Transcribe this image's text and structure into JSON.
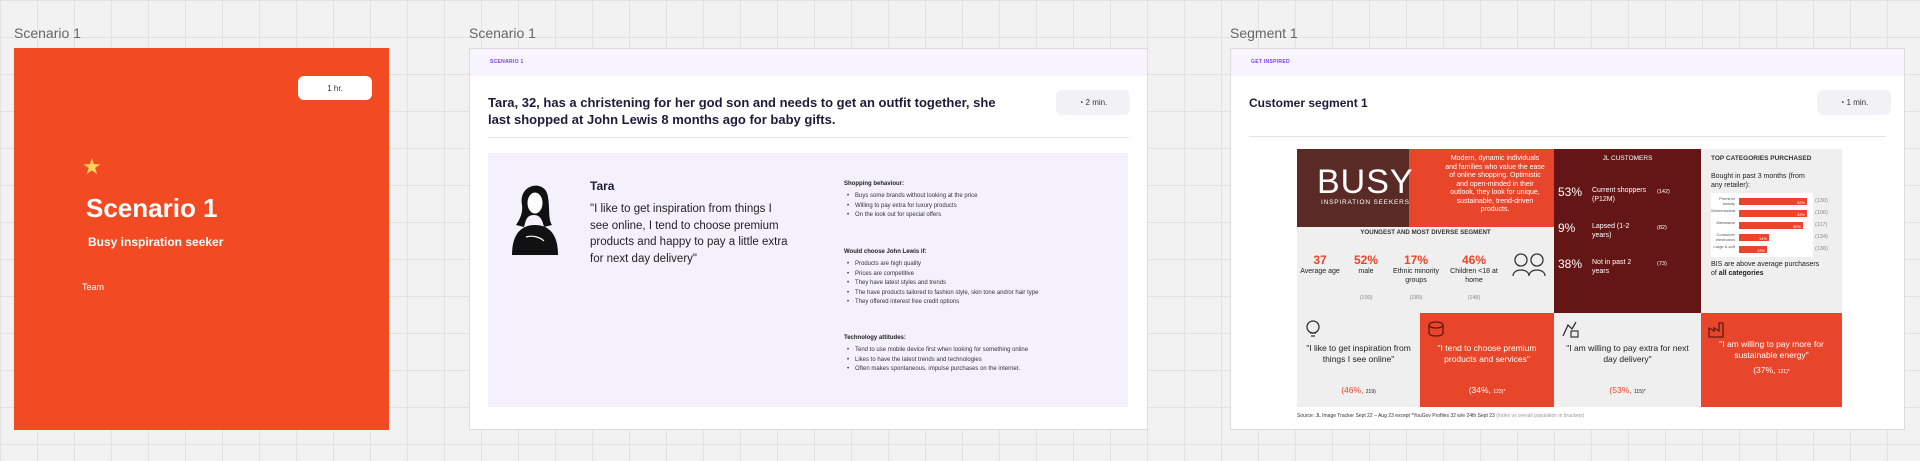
{
  "frames": {
    "f1_label": "Scenario 1",
    "f2_label": "Scenario 1",
    "f3_label": "Segment 1"
  },
  "scenario_card": {
    "duration": "1 hr.",
    "icon": "star-icon",
    "title": "Scenario 1",
    "subtitle": "Busy inspiration seeker",
    "team_label": "Team",
    "bg_color": "#f24a23"
  },
  "scenario_frame": {
    "tag": "SCENARIO 1",
    "duration": "2 min.",
    "heading": "Tara, 32, has a christening for her god son and needs to get an outfit together, she last shopped at John Lewis 8 months ago for baby gifts.",
    "persona": {
      "name": "Tara",
      "quote": "\"I like to get inspiration from things I see online, I tend to choose premium products and happy to pay a little extra for next day delivery\"",
      "sections": [
        {
          "title": "Shopping behaviour:",
          "items": [
            "Buys some brands without looking at the price",
            "Willing to pay extra for luxury products",
            "On the look out for special offers"
          ]
        },
        {
          "title": "Would choose John Lewis if:",
          "items": [
            "Products are high quality",
            "Prices are competitive",
            "They have latest styles and trends",
            "The have products tailored to fashion style, skin tone and/or hair type",
            "They offered interest free credit options"
          ]
        },
        {
          "title": "Technology attitudes:",
          "items": [
            "Tend to use mobile device first when looking for something online",
            "Likes to have the latest trends and technologies",
            "Often makes spontaneous, impulse purchases on the internet."
          ]
        }
      ]
    }
  },
  "segment_frame": {
    "tag": "GET INSPIRED",
    "duration": "1 min.",
    "heading": "Customer segment 1",
    "info": {
      "busy_word": "BUSY",
      "busy_sub": "INSPIRATION SEEKERS",
      "busy_desc": "Modern, dynamic individuals and families who value the ease of online shopping. Optimistic and open-minded in their outlook, they look for unique, sustainable, trend-driven products.",
      "segment_label": "YOUNGEST AND MOST DIVERSE SEGMENT",
      "stats": [
        {
          "value": "37",
          "label": "Average age",
          "index": ""
        },
        {
          "value": "52%",
          "label": "male",
          "index": "(100)"
        },
        {
          "value": "17%",
          "label": "Ethnic minority groups",
          "index": "(189)"
        },
        {
          "value": "46%",
          "label": "Children <18 at home",
          "index": "(148)"
        }
      ],
      "jl_header": "JL CUSTOMERS",
      "jl_rows": [
        {
          "pct": "53%",
          "label": "Current shoppers (P12M)",
          "index": "(142)"
        },
        {
          "pct": "9%",
          "label": "Lapsed (1-2 years)",
          "index": "(82)"
        },
        {
          "pct": "38%",
          "label": "Not in past 2 years",
          "index": "(73)"
        }
      ],
      "cat_header": "TOP CATEGORIES PURCHASED",
      "cat_sub": "Bought in past 3 months (from any retailer):",
      "categories": [
        {
          "name": "Premium beauty",
          "value": 32,
          "label": "32%",
          "index": "(130)"
        },
        {
          "name": "Womenswear",
          "value": 32,
          "label": "32%",
          "index": "(106)"
        },
        {
          "name": "Menswear",
          "value": 30,
          "label": "30%",
          "index": "(117)"
        },
        {
          "name": "Consumer electronics",
          "value": 14,
          "label": "14%",
          "index": "(134)"
        },
        {
          "name": "Large & soft",
          "value": 13,
          "label": "13%",
          "index": "(136)"
        }
      ],
      "cat_foot_a": "BIS are above average purchasers of ",
      "cat_foot_b": "all categories",
      "quotes": [
        {
          "text": "\"I like to get inspiration from things I see online\"",
          "pct": "(46%,",
          "idx": "219)",
          "theme": "light",
          "icon": "lightbulb-icon"
        },
        {
          "text": "\"I tend to choose premium products and services\"",
          "pct": "(34%,",
          "idx": "123)*",
          "theme": "orange",
          "icon": "coins-icon"
        },
        {
          "text": "\"I am willing to pay extra for next day delivery\"",
          "pct": "(53%,",
          "idx": "115)*",
          "theme": "light",
          "icon": "delivery-icon"
        },
        {
          "text": "\"I am willing to pay more for sustainable energy\"",
          "pct": "(37%,",
          "idx": "121)*",
          "theme": "orange",
          "icon": "factory-icon"
        }
      ],
      "source_a": "Source: JL Image Tracker Sept 22 – Aug 23 except *YouGov Profiles 32 w/e 24th Sept 23 ",
      "source_b": "(Index vs overall population in brackets)"
    }
  },
  "colors": {
    "accent": "#e8462a",
    "maroon": "#641616",
    "navy": "#1f1b3a",
    "purple_tag": "#7a3cff",
    "lavender": "#f4f1fd"
  }
}
